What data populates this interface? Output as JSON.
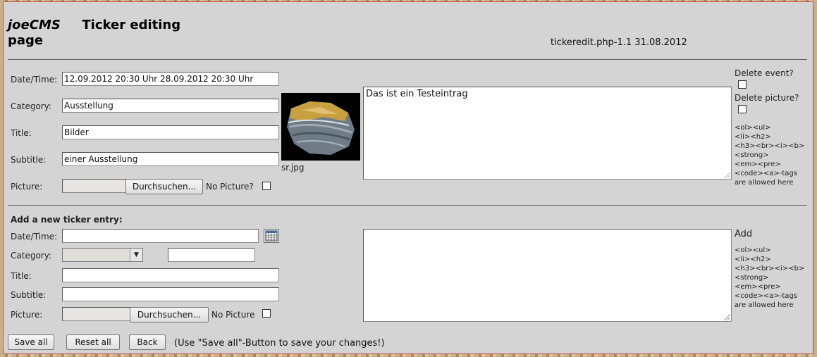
{
  "header": {
    "brand": "joeCMS",
    "title_line1": "Ticker editing",
    "title_line2": "page",
    "version": "tickeredit.php-1.1 31.08.2012"
  },
  "edit": {
    "labels": {
      "datetime": "Date/Time:",
      "category": "Category:",
      "title": "Title:",
      "subtitle": "Subtitle:",
      "picture": "Picture:"
    },
    "datetime_value": "12.09.2012 20:30 Uhr 28.09.2012 20:30 Uhr",
    "category_value": "Ausstellung",
    "title_value": "Bilder",
    "subtitle_value": "einer Ausstellung",
    "browse_label": "Durchsuchen...",
    "no_picture_label": "No Picture?",
    "image_caption": "sr.jpg",
    "text_value": "Das ist ein Testeintrag",
    "delete_event_label": "Delete event?",
    "delete_picture_label": "Delete picture?",
    "tags_note": "<ol><ul>\n<li><h2>\n<h3><br><i><b>\n<strong>\n<em><pre>\n<code><a>-tags\nare allowed here"
  },
  "new_entry": {
    "heading": "Add a new ticker entry:",
    "labels": {
      "datetime": "Date/Time:",
      "category": "Category:",
      "title": "Title:",
      "subtitle": "Subtitle:",
      "picture": "Picture:"
    },
    "datetime_value": "",
    "category_selected": "",
    "category_new_value": "",
    "title_value": "",
    "subtitle_value": "",
    "browse_label": "Durchsuchen...",
    "no_picture_label": "No Picture",
    "text_value": "",
    "add_label": "Add",
    "tags_note": "<ol><ul>\n<li><h2>\n<h3><br><i><b>\n<strong>\n<em><pre>\n<code><a>-tags\nare allowed here"
  },
  "footer": {
    "save_all": "Save all",
    "reset_all": "Reset all",
    "back": "Back",
    "hint": "(Use \"Save all\"-Button to save your changes!)"
  }
}
